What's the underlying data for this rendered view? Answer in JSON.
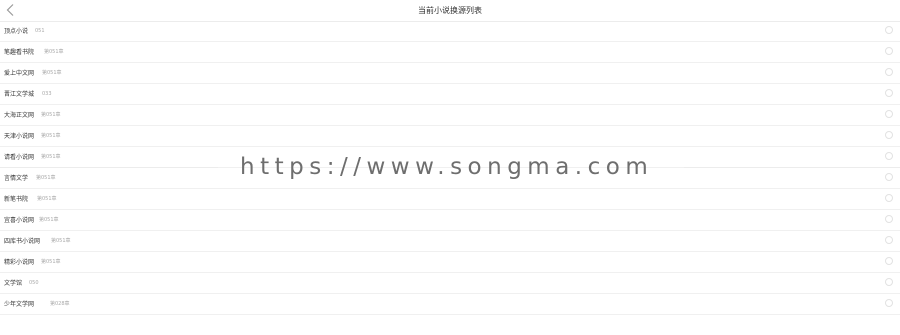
{
  "header": {
    "title": "当前小说换源列表",
    "back_icon": "chevron-left-icon"
  },
  "sources": [
    {
      "name": "顶点小说",
      "chapter": "051"
    },
    {
      "name": "笔趣看书院",
      "chapter": "第051章"
    },
    {
      "name": "爱上中文网",
      "chapter": "第051章"
    },
    {
      "name": "晋江文学城",
      "chapter": "033"
    },
    {
      "name": "大海正文网",
      "chapter": "第051章"
    },
    {
      "name": "天津小说网",
      "chapter": "第051章"
    },
    {
      "name": "请看小说网",
      "chapter": "第051章"
    },
    {
      "name": "言情文学",
      "chapter": "第051章"
    },
    {
      "name": "新笔书院",
      "chapter": "第051章"
    },
    {
      "name": "宜喜小说网",
      "chapter": "第051章"
    },
    {
      "name": "四库书小说网",
      "chapter": "第051章"
    },
    {
      "name": "精彩小说网",
      "chapter": "第051章"
    },
    {
      "name": "文学馆",
      "chapter": "050"
    },
    {
      "name": "少年文学网",
      "chapter": "第028章"
    }
  ],
  "watermark": {
    "text": "https://www.songma.com"
  }
}
